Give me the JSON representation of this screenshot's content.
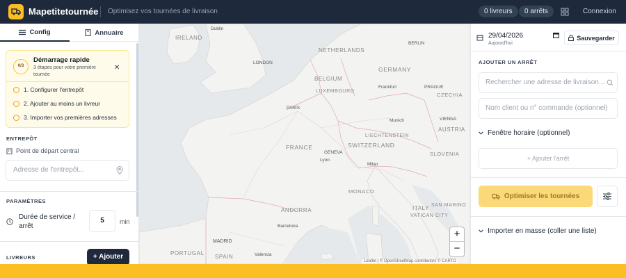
{
  "header": {
    "brand": "Mapetitetournée",
    "tagline": "Optimisez vos tournées de livraison",
    "drivers_count": "0 livreurs",
    "stops_count": "0 arrêts",
    "login": "Connexion"
  },
  "tabs": [
    {
      "label": "Config"
    },
    {
      "label": "Annuaire"
    }
  ],
  "quick_start": {
    "badge": "0/3",
    "title": "Démarrage rapide",
    "subtitle": "3 étapes pour votre première tournée",
    "close": "✕",
    "steps": [
      "1. Configurer l'entrepôt",
      "2. Ajouter au moins un livreur",
      "3. Importer vos premières adresses"
    ]
  },
  "depot": {
    "section": "ENTREPÔT",
    "label": "Point de départ central",
    "placeholder": "Adresse de l'entrepôt..."
  },
  "params": {
    "section": "PARAMÈTRES",
    "service_label": "Durée de service / arrêt",
    "service_value": "5",
    "unit": "min"
  },
  "drivers": {
    "section": "LIVREURS",
    "add_button": "+ Ajouter"
  },
  "map": {
    "labels": [
      "Dublin",
      "IRELAND",
      "LONDON",
      "NETHERLANDS",
      "BERLIN",
      "GERMANY",
      "BELGIUM",
      "LUXEMBOURG",
      "Frankfurt",
      "PRAGUE",
      "CZECHIA",
      "PARIS",
      "Munich",
      "VIENNA",
      "AUSTRIA",
      "FRANCE",
      "GENEVA",
      "SWITZERLAND",
      "LIECHTENSTEIN",
      "Lyon",
      "Milan",
      "SLOVENIA",
      "MONACO",
      "SAN MARINO",
      "ANDORRA",
      "ITALY",
      "VATICAN CITY",
      "Barcelona",
      "MADRID",
      "PORTUGAL",
      "SPAIN",
      "Valencia"
    ],
    "zoom_in": "+",
    "zoom_out": "−",
    "attribution": "Leaflet | © OpenStreetMap contributors © CARTO"
  },
  "right": {
    "date": "29/04/2026",
    "date_sub": "Aujourd'hui",
    "save": "Sauvegarder",
    "add_stop_section": "AJOUTER UN ARRÊT",
    "address_placeholder": "Rechercher une adresse de livraison...",
    "client_placeholder": "Nom client ou n° commande (optionnel)",
    "time_window": "Fenêtre horaire (optionnel)",
    "add_stop": "+ Ajouter l'arrêt",
    "optimize": "Optimiser les tournées",
    "bulk_import": "Importer en masse (coller une liste)"
  }
}
